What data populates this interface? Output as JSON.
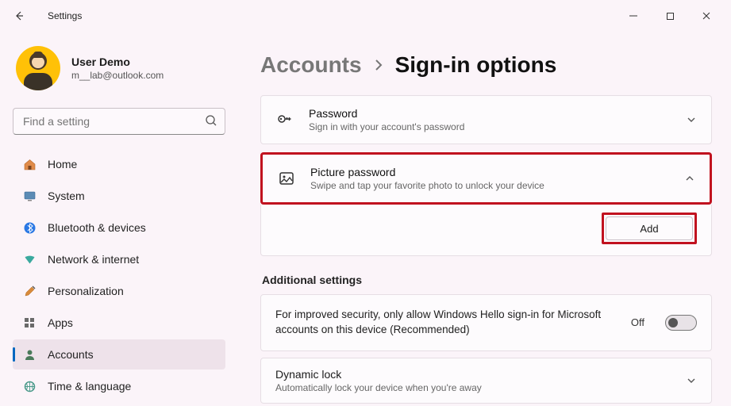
{
  "titlebar": {
    "title": "Settings"
  },
  "user": {
    "name": "User Demo",
    "email": "m__lab@outlook.com"
  },
  "search": {
    "placeholder": "Find a setting"
  },
  "nav": {
    "items": [
      {
        "label": "Home"
      },
      {
        "label": "System"
      },
      {
        "label": "Bluetooth & devices"
      },
      {
        "label": "Network & internet"
      },
      {
        "label": "Personalization"
      },
      {
        "label": "Apps"
      },
      {
        "label": "Accounts"
      },
      {
        "label": "Time & language"
      }
    ]
  },
  "breadcrumb": {
    "parent": "Accounts",
    "current": "Sign-in options"
  },
  "password_card": {
    "title": "Password",
    "desc": "Sign in with your account's password"
  },
  "picture_card": {
    "title": "Picture password",
    "desc": "Swipe and tap your favorite photo to unlock your device",
    "add_label": "Add"
  },
  "additional_label": "Additional settings",
  "hello_card": {
    "text": "For improved security, only allow Windows Hello sign-in for Microsoft accounts on this device (Recommended)",
    "off": "Off"
  },
  "dynamic_card": {
    "title": "Dynamic lock",
    "desc": "Automatically lock your device when you're away"
  }
}
